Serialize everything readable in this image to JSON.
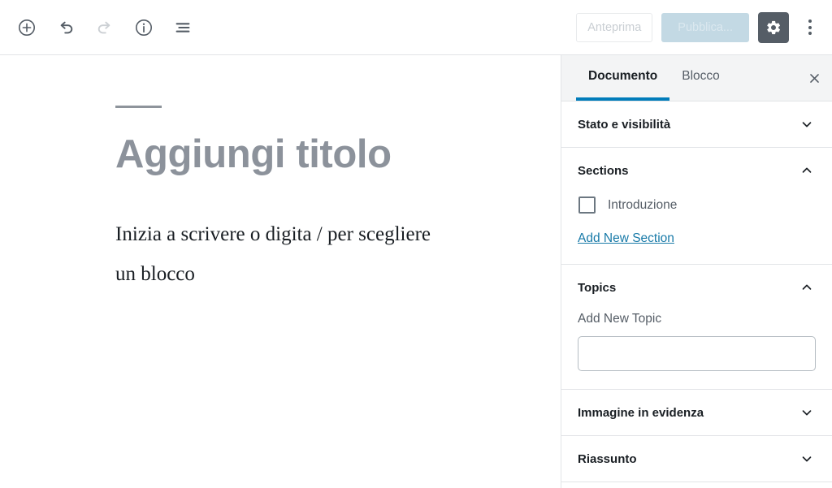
{
  "header": {
    "tools": [
      {
        "name": "add-block-icon",
        "label": "Aggiungi blocco",
        "state": "enabled"
      },
      {
        "name": "undo-icon",
        "label": "Annulla",
        "state": "enabled"
      },
      {
        "name": "redo-icon",
        "label": "Ripeti",
        "state": "disabled"
      },
      {
        "name": "info-icon",
        "label": "Informazioni sul contenuto",
        "state": "enabled"
      },
      {
        "name": "list-view-icon",
        "label": "Struttura del contenuto",
        "state": "enabled"
      }
    ],
    "preview_label": "Anteprima",
    "publish_label": "Pubblica...",
    "settings_label": "Impostazioni",
    "more_label": "Altri strumenti e opzioni"
  },
  "editor": {
    "title_placeholder": "Aggiungi titolo",
    "body_placeholder": "Inizia a scrivere o digita / per scegliere un blocco"
  },
  "sidebar": {
    "tabs": [
      {
        "label": "Documento",
        "active": true
      },
      {
        "label": "Blocco",
        "active": false
      }
    ],
    "close_label": "Chiudi impostazioni",
    "panels": [
      {
        "title": "Stato e visibilità",
        "expanded": false,
        "chevron": "chevron-down-icon"
      },
      {
        "title": "Sections",
        "expanded": true,
        "chevron": "chevron-up-icon",
        "checkbox_label": "Introduzione",
        "checkbox_checked": false,
        "link_label": "Add New Section"
      },
      {
        "title": "Topics",
        "expanded": true,
        "chevron": "chevron-up-icon",
        "field_label": "Add New Topic",
        "field_value": "",
        "field_placeholder": ""
      },
      {
        "title": "Immagine in evidenza",
        "expanded": false,
        "chevron": "chevron-down-icon"
      },
      {
        "title": "Riassunto",
        "expanded": false,
        "chevron": "chevron-down-icon"
      }
    ]
  },
  "colors": {
    "accent_blue": "#007cba",
    "link_blue": "#187aa8",
    "publish_bg": "#c3d9e4",
    "gear_bg": "#555d66",
    "title_gray": "#8c929b",
    "border": "#e2e4e7"
  }
}
